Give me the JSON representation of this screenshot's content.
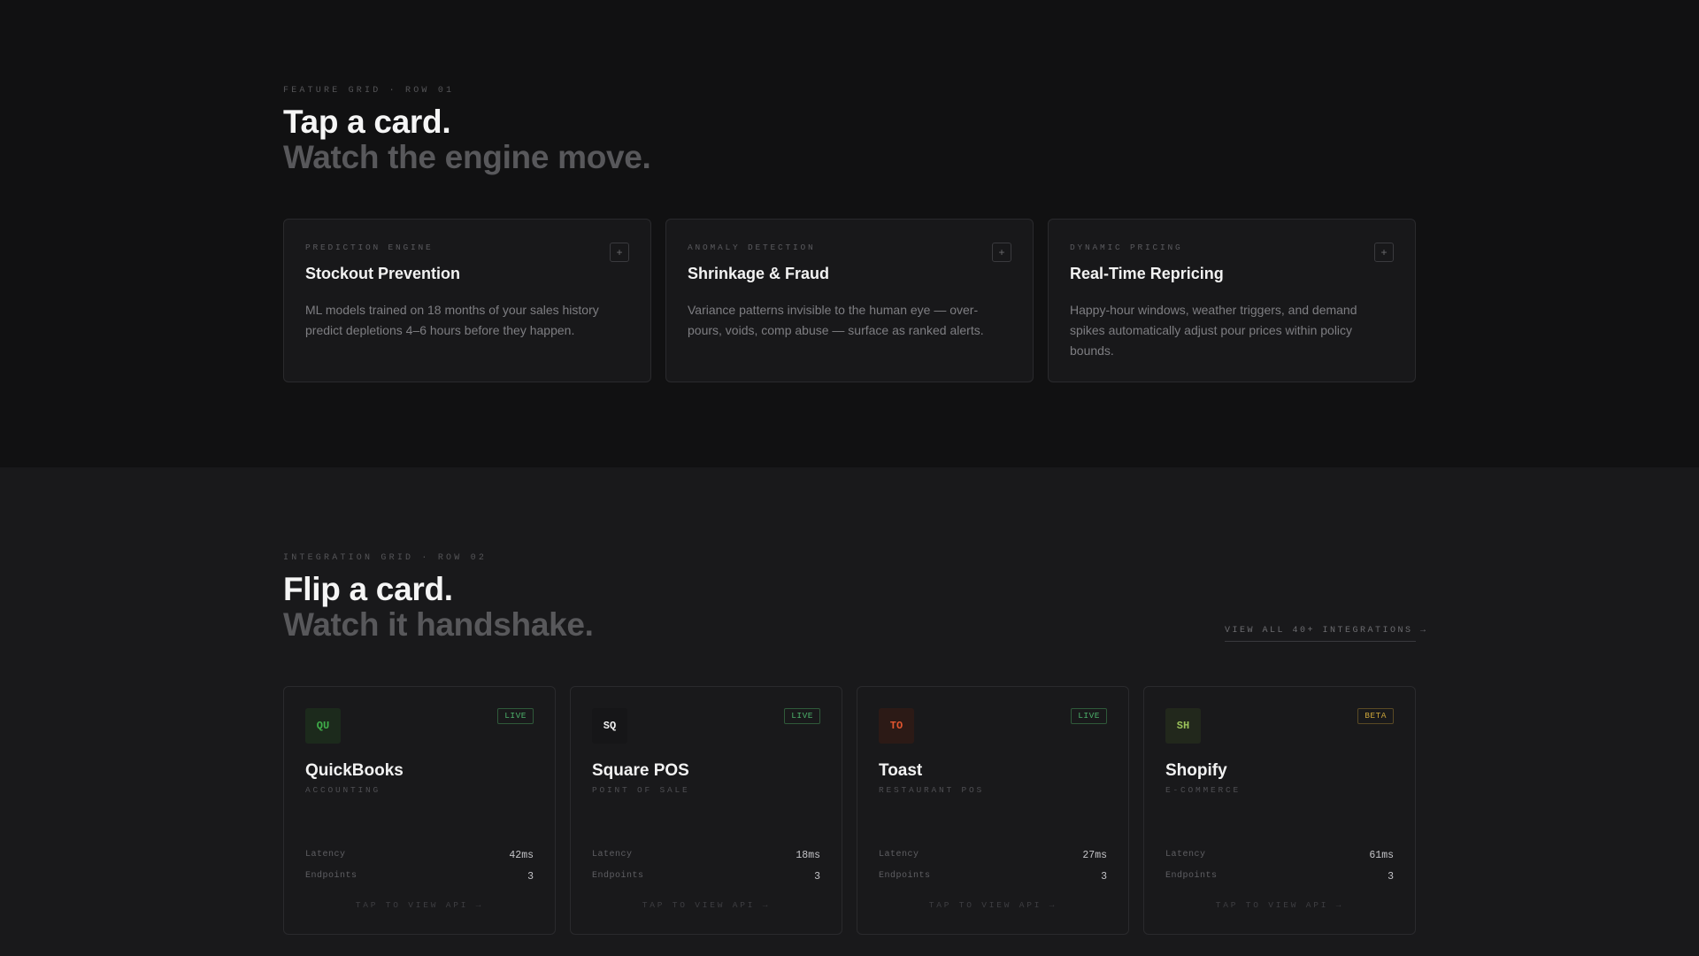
{
  "feature_section": {
    "eyebrow": "FEATURE GRID · ROW 01",
    "heading_main": "Tap a card.",
    "heading_sub": "Watch the engine move.",
    "cards": [
      {
        "category": "PREDICTION ENGINE",
        "title": "Stockout Prevention",
        "description": "ML models trained on 18 months of your sales history predict depletions 4–6 hours before they happen.",
        "toggle": "+"
      },
      {
        "category": "ANOMALY DETECTION",
        "title": "Shrinkage & Fraud",
        "description": "Variance patterns invisible to the human eye — over-pours, voids, comp abuse — surface as ranked alerts.",
        "toggle": "+"
      },
      {
        "category": "DYNAMIC PRICING",
        "title": "Real-Time Repricing",
        "description": "Happy-hour windows, weather triggers, and demand spikes automatically adjust pour prices within policy bounds.",
        "toggle": "+"
      }
    ]
  },
  "integration_section": {
    "eyebrow": "INTEGRATION GRID · ROW 02",
    "heading_main": "Flip a card.",
    "heading_sub": "Watch it handshake.",
    "view_all_link": "VIEW ALL 40+ INTEGRATIONS →",
    "latency_label": "Latency",
    "endpoints_label": "Endpoints",
    "cards": [
      {
        "abbr": "QU",
        "name": "QuickBooks",
        "type": "ACCOUNTING",
        "status": "LIVE",
        "latency": "42ms",
        "endpoints": "3",
        "cta": "TAP TO VIEW API →",
        "logo_bg": "#1c2a1c",
        "logo_fg": "#3fae4a",
        "badge_color": "#4caf6a",
        "badge_border": "#2f5a3a"
      },
      {
        "abbr": "SQ",
        "name": "Square POS",
        "type": "POINT OF SALE",
        "status": "LIVE",
        "latency": "18ms",
        "endpoints": "3",
        "cta": "TAP TO VIEW API →",
        "logo_bg": "#161618",
        "logo_fg": "#f0f0f0",
        "badge_color": "#4caf6a",
        "badge_border": "#2f5a3a"
      },
      {
        "abbr": "TO",
        "name": "Toast",
        "type": "RESTAURANT POS",
        "status": "LIVE",
        "latency": "27ms",
        "endpoints": "3",
        "cta": "TAP TO VIEW API →",
        "logo_bg": "#2c1a16",
        "logo_fg": "#e0552f",
        "badge_color": "#4caf6a",
        "badge_border": "#2f5a3a"
      },
      {
        "abbr": "SH",
        "name": "Shopify",
        "type": "E-COMMERCE",
        "status": "BETA",
        "latency": "61ms",
        "endpoints": "3",
        "cta": "TAP TO VIEW API →",
        "logo_bg": "#22281c",
        "logo_fg": "#9bc25a",
        "badge_color": "#c8a23a",
        "badge_border": "#5a4a24"
      }
    ]
  }
}
